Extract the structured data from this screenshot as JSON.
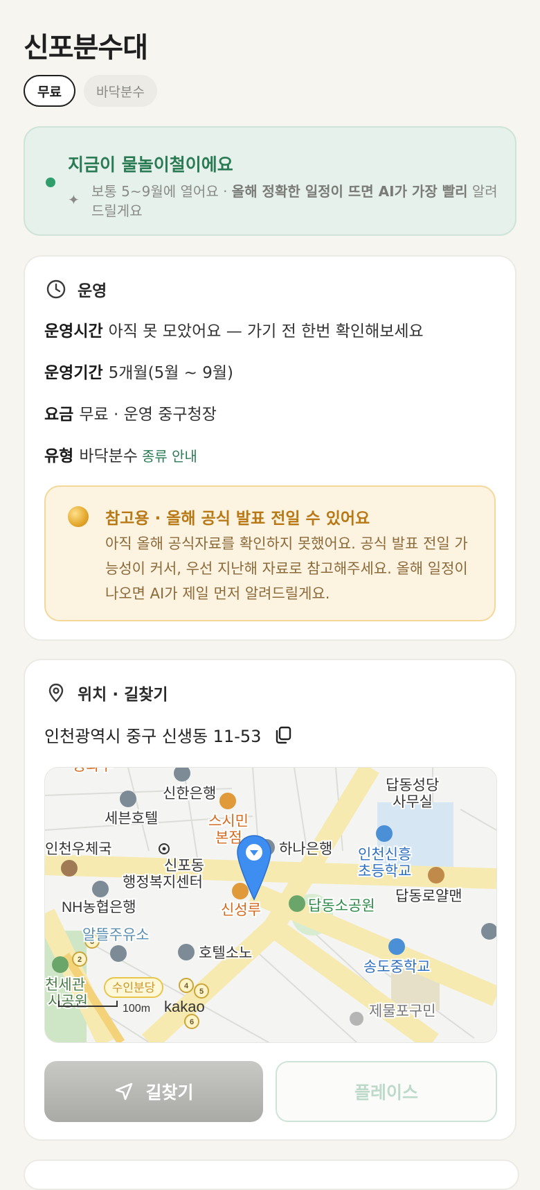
{
  "title": "신포분수대",
  "chips": [
    {
      "label": "무료",
      "active": true
    },
    {
      "label": "바닥분수",
      "active": false
    }
  ],
  "season": {
    "headline": "지금이 물놀이철이에요",
    "sub_prefix": "보통 5~9월에 열어요 · ",
    "sub_bold": "올해 정확한 일정이 뜨면 AI가 가장 빨리",
    "sub_suffix": "알려드릴게요"
  },
  "operation": {
    "section_label": "운영",
    "rows": [
      {
        "key": "운영시간",
        "value": "아직 못 모았어요 — 가기 전 한번 확인해보세요"
      },
      {
        "key": "운영기간",
        "value": "5개월(5월 ~ 9월)"
      },
      {
        "key": "요금",
        "value": "무료 · 운영 중구청장"
      },
      {
        "key": "유형",
        "value": "바닥분수",
        "link": "종류 안내"
      }
    ],
    "notice": {
      "headline": "참고용 · 올해 공식 발표 전일 수 있어요",
      "body": "아직 올해 공식자료를 확인하지 못했어요. 공식 발표 전일 가능성이 커서, 우선 지난해 자료로 참고해주세요. 올해 일정이 나오면 AI가 제일 먼저 알려드릴게요."
    }
  },
  "location": {
    "section_label": "위치 · 길찾기",
    "address": "인천광역시 중구 신생동 11-53",
    "map": {
      "labels": {
        "shinhan": "신한은행",
        "sebun": "세븐호텔",
        "sushi1": "스시민",
        "sushi2": "본점",
        "hana": "하나은행",
        "post": "인천우체국",
        "sinpo1": "신포동",
        "sinpo2": "행정복지센터",
        "nh": "NH농협은행",
        "gas": "알뜰주유소",
        "shinseong": "신성루",
        "park": "답동소공원",
        "church1": "답동성당",
        "church2": "사무실",
        "school1": "인천신흥",
        "school2": "초등학교",
        "hospital": "답동로얄맨",
        "middle": "송도중학교",
        "hotel": "호텔소노",
        "gw1": "천세관",
        "gw2": "시공원",
        "suin": "수인분당",
        "jemul1": "제물포구민",
        "scale": "100m",
        "brand": "kakao",
        "top": "공화루",
        "n2": "2",
        "n3": "3",
        "n4": "4",
        "n5": "5",
        "n6": "6"
      }
    },
    "directions_label": "길찾기",
    "place_label": "플레이스"
  },
  "colors": {
    "accent_green": "#2f9e6a",
    "notice_text": "#b87815",
    "map_pin": "#3d8ef0"
  }
}
